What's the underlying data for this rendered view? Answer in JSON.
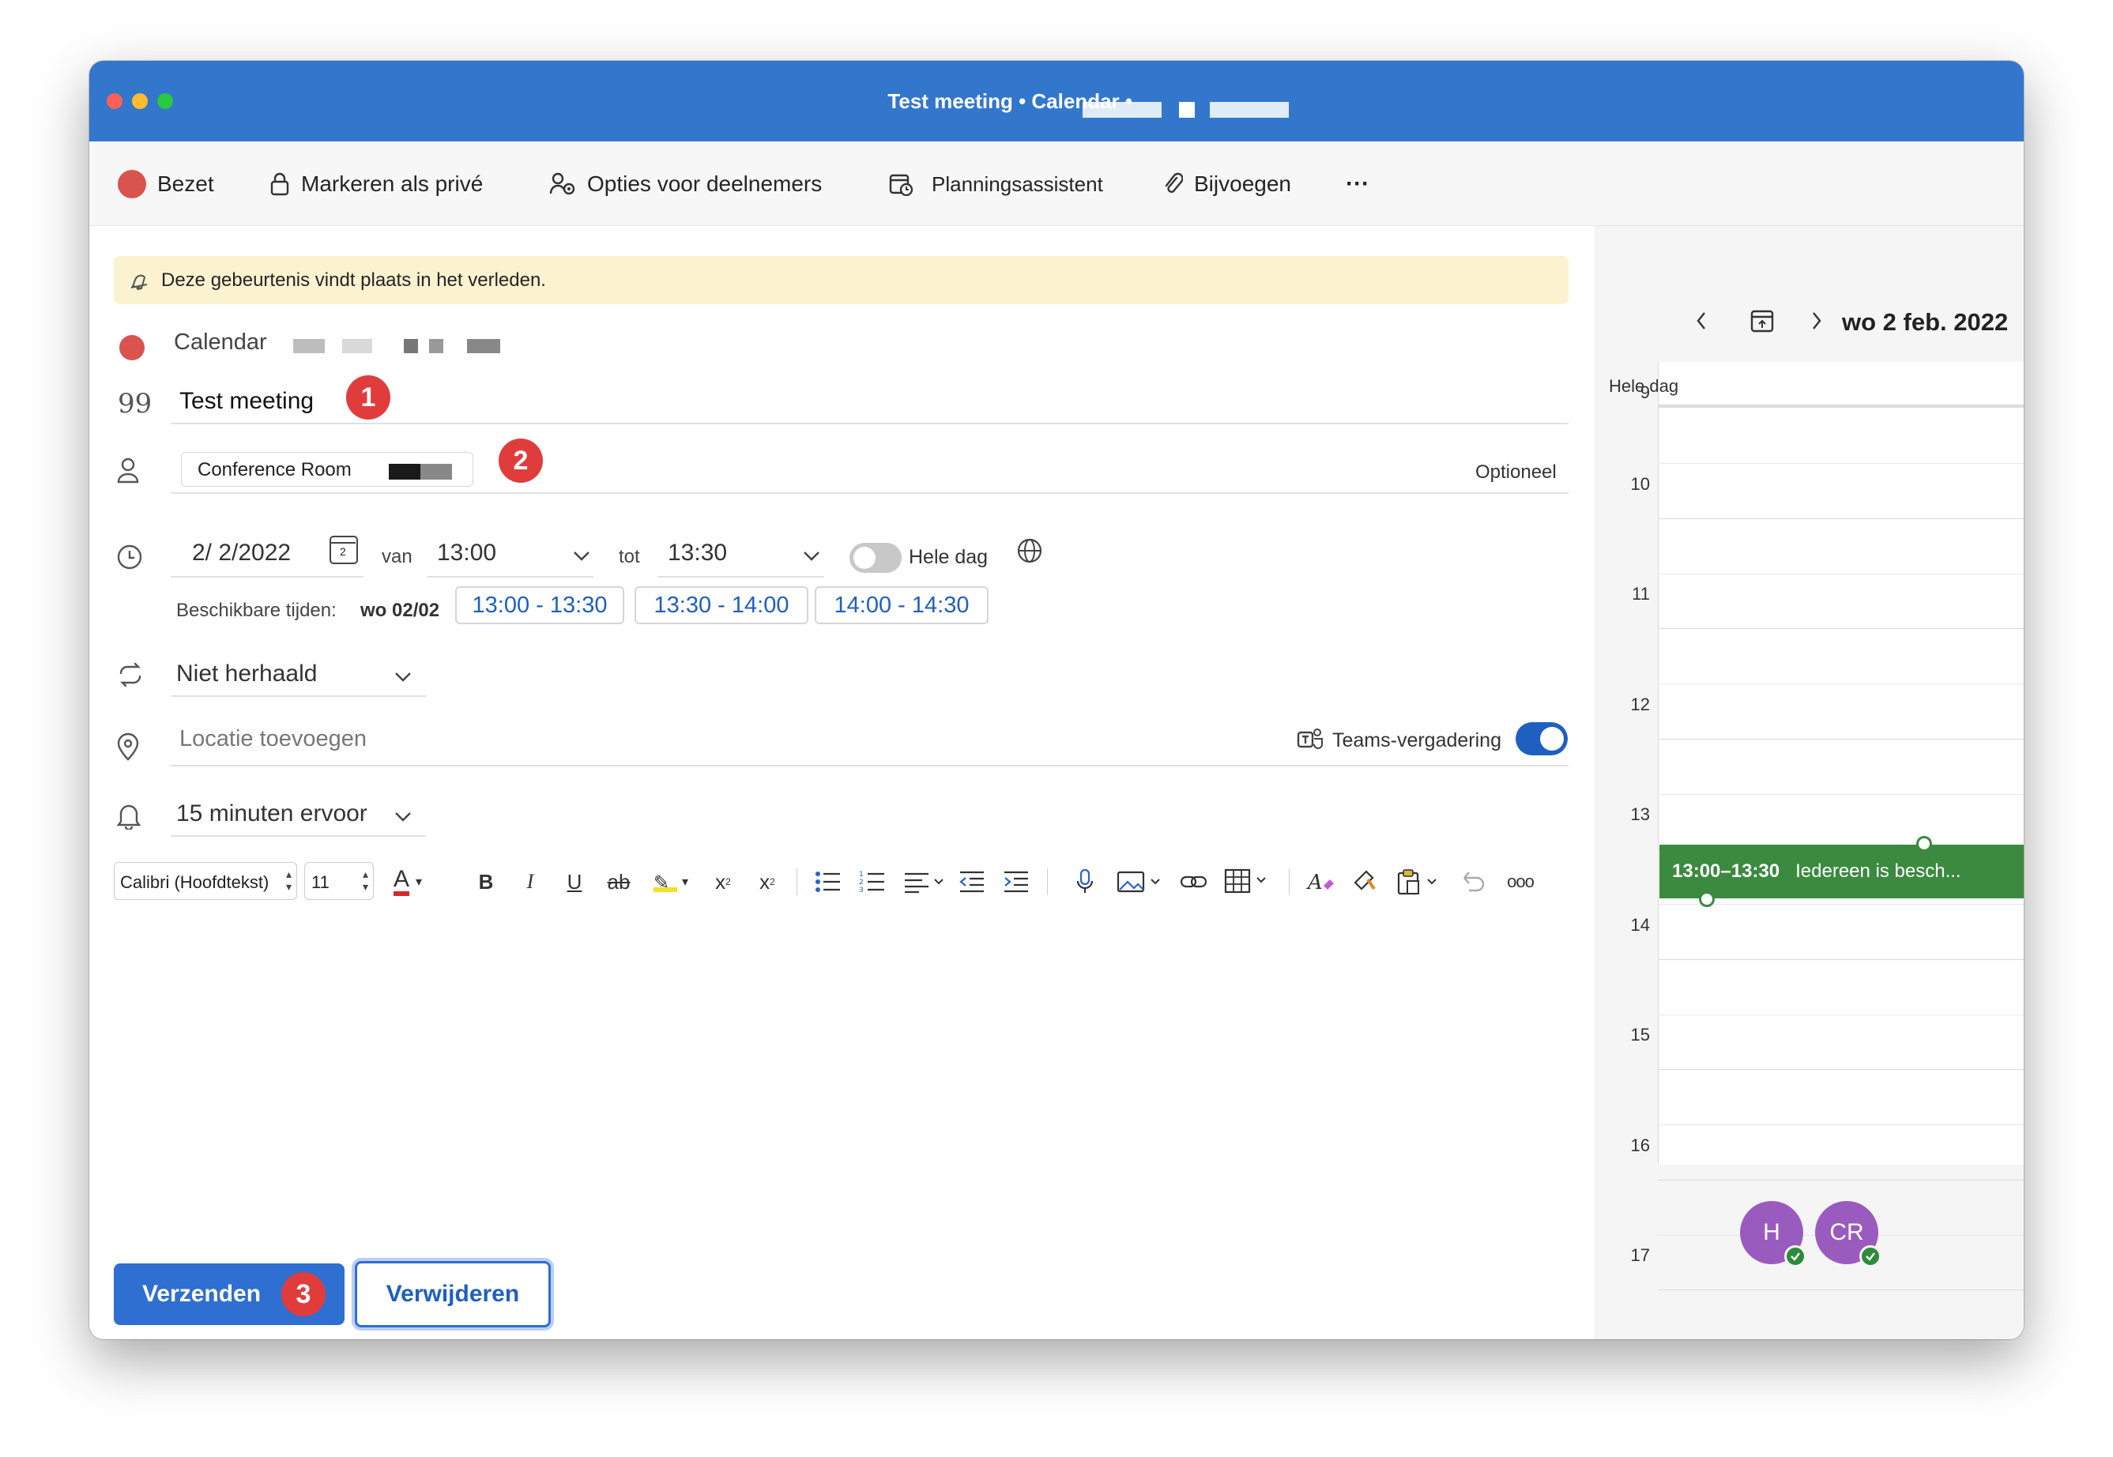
{
  "window": {
    "title": "Test meeting • Calendar •"
  },
  "toolbar": {
    "status_label": "Bezet",
    "private_label": "Markeren als privé",
    "attendee_options_label": "Opties voor deelnemers",
    "scheduling_label": "Planningsassistent",
    "attach_label": "Bijvoegen",
    "more_label": "···"
  },
  "banner": {
    "text": "Deze gebeurtenis vindt plaats in het verleden."
  },
  "form": {
    "calendar_label": "Calendar",
    "title_value": "Test meeting",
    "attendee_chip": "Conference Room",
    "optional_label": "Optioneel",
    "date_value": "2/ 2/2022",
    "date_icon_number": "2",
    "from_label": "van",
    "start_time": "13:00",
    "to_label": "tot",
    "end_time": "13:30",
    "all_day_label": "Hele dag",
    "available_label": "Beschikbare tijden:",
    "available_day": "wo 02/02",
    "slots": [
      "13:00 - 13:30",
      "13:30 - 14:00",
      "14:00 - 14:30"
    ],
    "repeat_value": "Niet herhaald",
    "location_placeholder": "Locatie toevoegen",
    "teams_label": "Teams-vergadering",
    "reminder_value": "15 minuten ervoor"
  },
  "editor": {
    "font_name": "Calibri (Hoofdtekst)",
    "font_size": "11"
  },
  "actions": {
    "send_label": "Verzenden",
    "delete_label": "Verwijderen"
  },
  "annotations": {
    "badge_1": "1",
    "badge_2": "2",
    "badge_3": "3"
  },
  "calendar_panel": {
    "date_label": "wo 2 feb. 2022",
    "all_day_label": "Hele dag",
    "hours": [
      "9",
      "10",
      "11",
      "12",
      "13",
      "14",
      "15",
      "16",
      "17"
    ],
    "event_time": "13:00–13:30",
    "event_text": "Iedereen is besch...",
    "event_color": "#3b8a3f",
    "avatars": [
      "H",
      "CR"
    ]
  },
  "colors": {
    "titlebar": "#3377cc",
    "accent": "#2f6fd1",
    "busy": "#d9534f",
    "badge": "#e03c3c"
  }
}
